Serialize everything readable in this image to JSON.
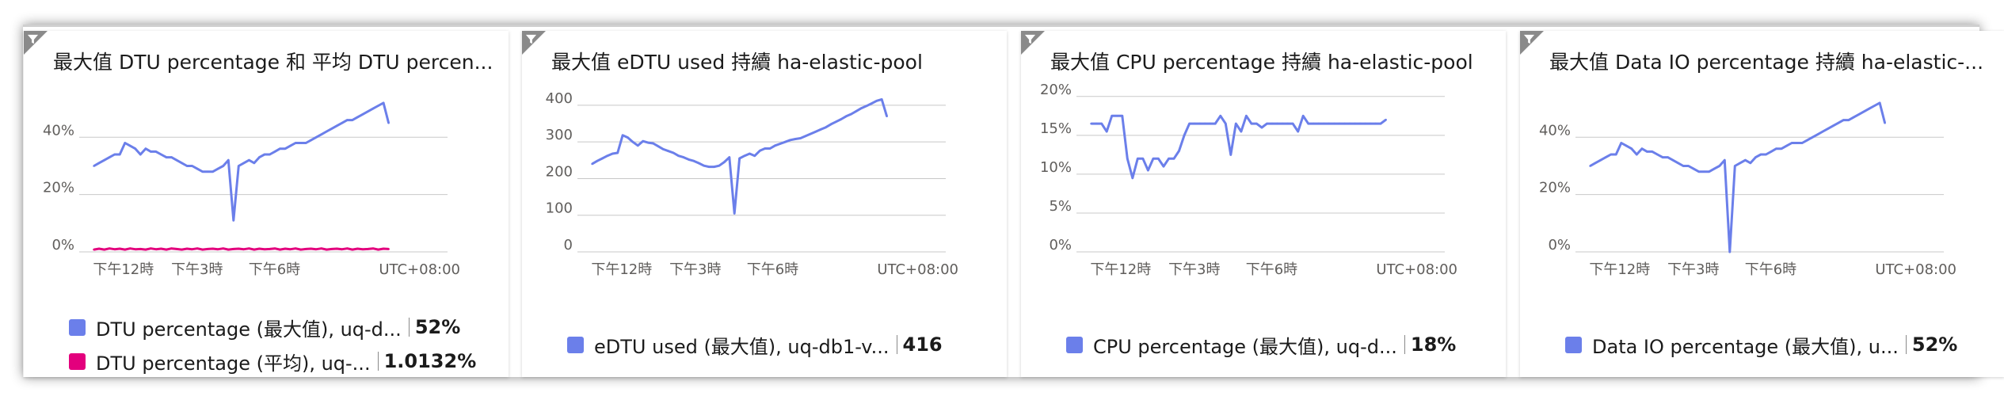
{
  "colors": {
    "blue": "#6b7fea",
    "pink": "#e3007d",
    "grid": "#c8c8c8"
  },
  "tiles": [
    {
      "title": "最大值 DTU percentage 和 平均 DTU percen...",
      "legend": [
        {
          "label": "DTU percentage (最大值), uq-d...",
          "value": "52%",
          "color": "#6b7fea"
        },
        {
          "label": "DTU percentage (平均), uq-...",
          "value": "1.0132%",
          "color": "#e3007d"
        }
      ]
    },
    {
      "title": "最大值 eDTU used 持續 ha-elastic-pool",
      "legend": [
        {
          "label": "eDTU used (最大值), uq-db1-v...",
          "value": "416",
          "color": "#6b7fea"
        }
      ]
    },
    {
      "title": "最大值 CPU percentage 持續 ha-elastic-pool",
      "legend": [
        {
          "label": "CPU percentage (最大值), uq-d...",
          "value": "18%",
          "color": "#6b7fea"
        }
      ]
    },
    {
      "title": "最大值 Data IO percentage 持續 ha-elastic-...",
      "legend": [
        {
          "label": "Data IO percentage (最大值), u...",
          "value": "52%",
          "color": "#6b7fea"
        }
      ]
    }
  ],
  "chart_data": [
    {
      "type": "line",
      "title": "最大值 DTU percentage 和 平均 DTU percen...",
      "yticks": [
        "0%",
        "20%",
        "40%"
      ],
      "ylim": [
        0,
        55
      ],
      "xticks": [
        "下午12時",
        "下午3時",
        "下午6時"
      ],
      "x_tick_pos": [
        0.12,
        0.32,
        0.53
      ],
      "timezone": "UTC+08:00",
      "grid": true,
      "series": [
        {
          "name": "DTU percentage (最大值), uq-d...",
          "color": "#6b7fea",
          "values": [
            30,
            31,
            32,
            33,
            34,
            34,
            38,
            37,
            36,
            34,
            36,
            35,
            35,
            34,
            33,
            33,
            32,
            31,
            30,
            30,
            29,
            28,
            28,
            28,
            29,
            30,
            32,
            11,
            30,
            31,
            32,
            31,
            33,
            34,
            34,
            35,
            36,
            36,
            37,
            38,
            38,
            38,
            39,
            40,
            41,
            42,
            43,
            44,
            45,
            46,
            46,
            47,
            48,
            49,
            50,
            51,
            52,
            45
          ]
        },
        {
          "name": "DTU percentage (平均), uq-...",
          "color": "#e3007d",
          "values": [
            0.8,
            1.1,
            0.8,
            1.2,
            0.9,
            1.1,
            0.8,
            1.2,
            0.9,
            1.0,
            0.8,
            1.2,
            0.9,
            1.1,
            0.8,
            1.2,
            1.0,
            0.8,
            1.1,
            0.9,
            1.2,
            0.8,
            1.0,
            1.1,
            0.9,
            1.2,
            0.8,
            1.0,
            1.1,
            0.9,
            1.2,
            0.8,
            1.1,
            0.9,
            1.0,
            1.2,
            0.8,
            1.1,
            0.9,
            1.2,
            0.8,
            1.0,
            1.1,
            0.9,
            1.2,
            0.8,
            1.0,
            1.1,
            0.9,
            1.2,
            0.8,
            1.1,
            0.9,
            1.0,
            1.2,
            0.8,
            1.1,
            1.0
          ]
        }
      ]
    },
    {
      "type": "line",
      "title": "最大值 eDTU used 持續 ha-elastic-pool",
      "yticks": [
        "0",
        "100",
        "200",
        "300",
        "400"
      ],
      "ylim": [
        0,
        430
      ],
      "xticks": [
        "下午12時",
        "下午3時",
        "下午6時"
      ],
      "x_tick_pos": [
        0.12,
        0.32,
        0.53
      ],
      "timezone": "UTC+08:00",
      "grid": true,
      "series": [
        {
          "name": "eDTU used (最大值), uq-db1-v...",
          "color": "#6b7fea",
          "values": [
            240,
            248,
            255,
            262,
            268,
            270,
            318,
            312,
            300,
            290,
            302,
            298,
            296,
            288,
            280,
            275,
            270,
            262,
            258,
            252,
            248,
            242,
            235,
            232,
            232,
            235,
            245,
            258,
            105,
            255,
            262,
            268,
            262,
            276,
            282,
            282,
            290,
            295,
            300,
            305,
            308,
            310,
            316,
            322,
            328,
            334,
            340,
            348,
            355,
            362,
            370,
            376,
            384,
            392,
            398,
            405,
            412,
            416,
            370
          ]
        }
      ]
    },
    {
      "type": "line",
      "title": "最大值 CPU percentage 持續 ha-elastic-pool",
      "yticks": [
        "0%",
        "5%",
        "10%",
        "15%",
        "20%"
      ],
      "ylim": [
        0,
        21
      ],
      "xticks": [
        "下午12時",
        "下午3時",
        "下午6時"
      ],
      "x_tick_pos": [
        0.12,
        0.32,
        0.53
      ],
      "timezone": "UTC+08:00",
      "grid": true,
      "series": [
        {
          "name": "CPU percentage (最大值), uq-d...",
          "color": "#6b7fea",
          "values": [
            16.5,
            16.5,
            16.5,
            15.5,
            17.5,
            17.5,
            17.5,
            12,
            9.5,
            12,
            12,
            10.5,
            12,
            12,
            11,
            12,
            12,
            13,
            15,
            16.5,
            16.5,
            16.5,
            16.5,
            16.5,
            16.5,
            17.5,
            16.5,
            12.5,
            16.5,
            15.5,
            17.5,
            16.5,
            16.5,
            16,
            16.5,
            16.5,
            16.5,
            16.5,
            16.5,
            16.5,
            15.5,
            17.5,
            16.5,
            16.5,
            16.5,
            16.5,
            16.5,
            16.5,
            16.5,
            16.5,
            16.5,
            16.5,
            16.5,
            16.5,
            16.5,
            16.5,
            16.5,
            17
          ]
        }
      ]
    },
    {
      "type": "line",
      "title": "最大值 Data IO percentage 持續 ha-elastic-...",
      "yticks": [
        "0%",
        "20%",
        "40%"
      ],
      "ylim": [
        0,
        55
      ],
      "xticks": [
        "下午12時",
        "下午3時",
        "下午6時"
      ],
      "x_tick_pos": [
        0.12,
        0.32,
        0.53
      ],
      "timezone": "UTC+08:00",
      "grid": true,
      "series": [
        {
          "name": "Data IO percentage (最大值), u...",
          "color": "#6b7fea",
          "values": [
            30,
            31,
            32,
            33,
            34,
            34,
            38,
            37,
            36,
            34,
            36,
            35,
            35,
            34,
            33,
            33,
            32,
            31,
            30,
            30,
            29,
            28,
            28,
            28,
            29,
            30,
            32,
            0,
            30,
            31,
            32,
            31,
            33,
            34,
            34,
            35,
            36,
            36,
            37,
            38,
            38,
            38,
            39,
            40,
            41,
            42,
            43,
            44,
            45,
            46,
            46,
            47,
            48,
            49,
            50,
            51,
            52,
            45
          ]
        }
      ]
    }
  ]
}
